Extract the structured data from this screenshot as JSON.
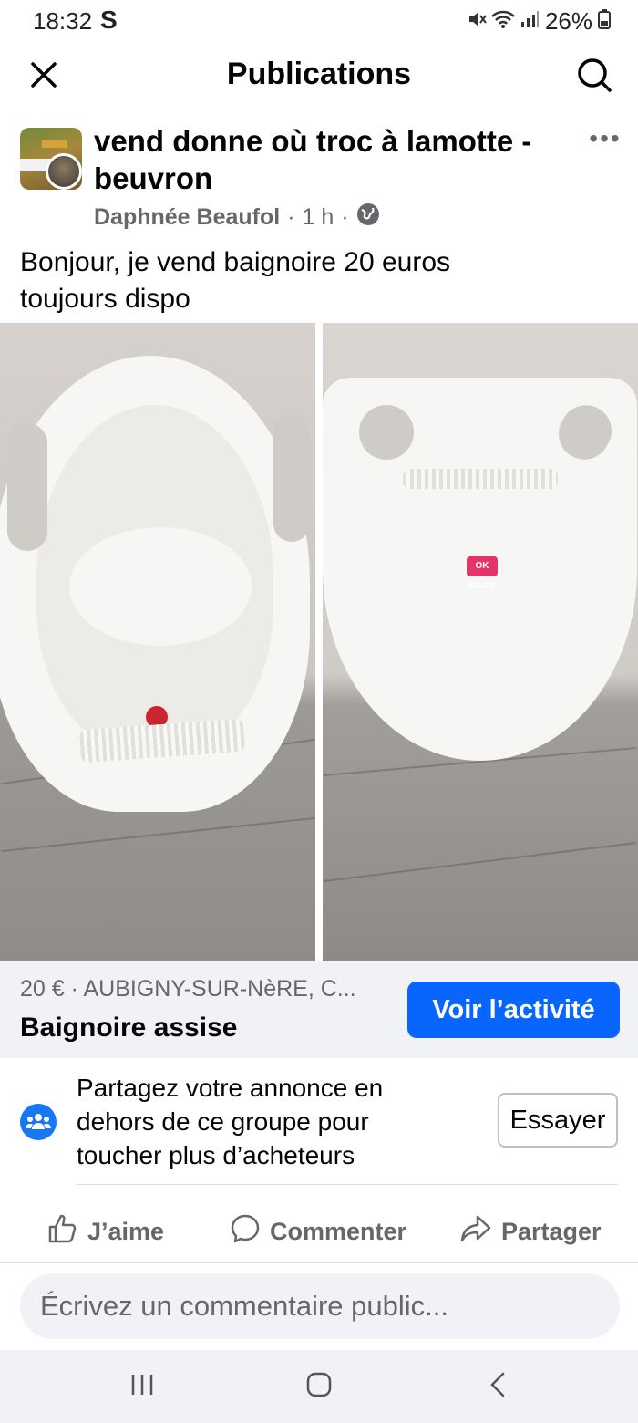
{
  "status_bar": {
    "time": "18:32",
    "carrier_glyph": "S",
    "battery": "26%",
    "icons": [
      "mute-icon",
      "wifi-icon",
      "signal-icon",
      "battery-icon"
    ]
  },
  "header": {
    "title": "Publications",
    "close_icon": "close-icon",
    "search_icon": "search-icon"
  },
  "post": {
    "group_name": "vend donne où troc à lamotte - beuvron",
    "author": "Daphnée Beaufol",
    "time": "1 h",
    "separator": "·",
    "privacy_icon": "globe-icon",
    "text_line1": "Bonjour, je vend baignoire 20 euros",
    "text_line2": "toujours dispo",
    "more_label": "•••"
  },
  "photos": {
    "brand_label": "OK BABY"
  },
  "listing": {
    "price_location": "20 € · AUBIGNY-SUR-NèRE, C...",
    "title": "Baignoire assise",
    "activity_button": "Voir l’activité"
  },
  "share_promo": {
    "line1": "Partagez votre annonce en",
    "line2": "dehors de ce groupe pour",
    "line3": "toucher plus d’acheteurs",
    "try_button": "Essayer",
    "icon": "group-icon"
  },
  "actions": {
    "like": "J’aime",
    "comment": "Commenter",
    "share": "Partager"
  },
  "comment": {
    "placeholder": "Écrivez un commentaire public..."
  },
  "colors": {
    "accent": "#0866ff",
    "secondary_text": "#65676b",
    "surface": "#f0f2f5"
  }
}
